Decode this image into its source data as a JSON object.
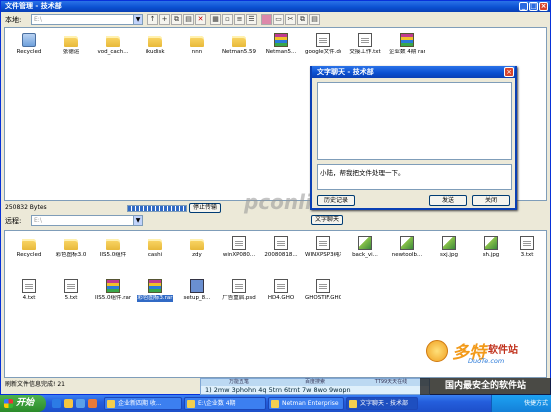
{
  "window": {
    "title": "文件管理 - 技术部"
  },
  "local": {
    "label": "本地:",
    "path_placeholder": "E:\\",
    "items": [
      {
        "name": "Recycled",
        "type": "bin"
      },
      {
        "name": "张德运",
        "type": "folder"
      },
      {
        "name": "vod_cach...",
        "type": "folder"
      },
      {
        "name": "ikudisk",
        "type": "folder"
      },
      {
        "name": "nnn",
        "type": "folder"
      },
      {
        "name": "Netman5.59",
        "type": "folder"
      },
      {
        "name": "Netman5...",
        "type": "rar"
      },
      {
        "name": "google文件.doc",
        "type": "doc"
      },
      {
        "name": "交接工作.txt",
        "type": "doc"
      },
      {
        "name": "企业数 4期 rar",
        "type": "rar"
      }
    ],
    "status": "250832 Bytes",
    "stop_button": "停止传输"
  },
  "remote": {
    "label": "远程:",
    "path_placeholder": "E:\\",
    "tab_label": "文字聊天",
    "items_row1": [
      {
        "name": "Recycled",
        "type": "folder"
      },
      {
        "name": "彩色图标3.0",
        "type": "folder"
      },
      {
        "name": "IIS5.0组件",
        "type": "folder"
      },
      {
        "name": "cashi",
        "type": "folder"
      },
      {
        "name": "zdy",
        "type": "folder"
      },
      {
        "name": "winXP080...",
        "type": "doc"
      },
      {
        "name": "20080818...",
        "type": "doc"
      },
      {
        "name": "WINXPSP3纯净的.GHO",
        "type": "doc"
      },
      {
        "name": "back_vi...",
        "type": "img"
      },
      {
        "name": "newtoolb...",
        "type": "img"
      },
      {
        "name": "sxj.jpg",
        "type": "img"
      },
      {
        "name": "sh.jpg",
        "type": "img"
      },
      {
        "name": "3.txt",
        "type": "doc"
      }
    ],
    "items_row2": [
      {
        "name": "4.txt",
        "type": "doc"
      },
      {
        "name": "5.txt",
        "type": "doc"
      },
      {
        "name": "IIS5.0组件.rar",
        "type": "rar"
      },
      {
        "name": "彩色图标3.rar",
        "type": "rar",
        "selected": true
      },
      {
        "name": "setup_8...",
        "type": "exe"
      },
      {
        "name": "广告重启.psd",
        "type": "doc"
      },
      {
        "name": "HD4.GHO",
        "type": "doc"
      },
      {
        "name": "GHOSTIF.GHO",
        "type": "doc"
      }
    ],
    "status": "刷新文件信息完成! 21"
  },
  "chat": {
    "title": "文字聊天 - 技术部",
    "message": "小陆，帮我把文件处理一下。",
    "history_button": "历史记录",
    "send_button": "发送",
    "close_button": "关闭"
  },
  "ime": {
    "tabs": [
      "万能五笔",
      "百度搜索",
      "TT99天天在线"
    ],
    "candidates": "1) 2mw 3phohn 4q 5trn 6trnt 7w 8wo 9wopn"
  },
  "taskbar": {
    "start": "开始",
    "tasks": [
      "企业新四期 收...",
      "E:\\企业数 4期",
      "Netman Enterprise",
      "文字聊天 - 技术部"
    ],
    "tray": "快捷方式"
  },
  "watermarks": {
    "pconline": "pconline.com",
    "brand_name": "多特",
    "brand_suffix": "软件站",
    "brand_url": "DuoTe.com",
    "secure": "国内最安全的软件站"
  },
  "toolbar_icons": [
    "folder-up-icon",
    "new-folder-icon",
    "copy-icon",
    "paste-icon",
    "delete-icon",
    "large-icons-icon",
    "small-icons-icon",
    "list-icon",
    "details-icon",
    "rar-icon",
    "page-icon",
    "cut-icon",
    "copy2-icon",
    "paste2-icon"
  ]
}
